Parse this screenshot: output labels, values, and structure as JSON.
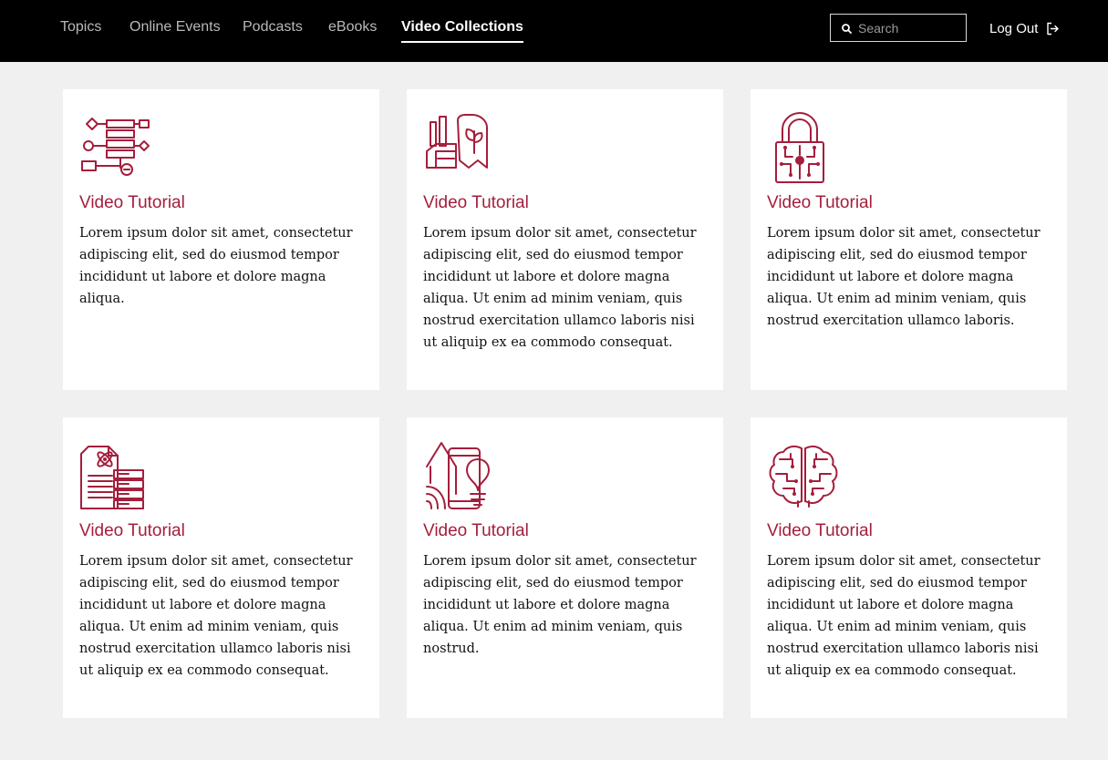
{
  "nav": {
    "items": [
      {
        "label": "Topics",
        "active": false
      },
      {
        "label": "Online Events",
        "active": false
      },
      {
        "label": "Podcasts",
        "active": false
      },
      {
        "label": "eBooks",
        "active": false
      },
      {
        "label": "Video Collections",
        "active": true
      }
    ],
    "search_placeholder": "Search",
    "logout_label": "Log Out"
  },
  "colors": {
    "accent": "#a51e3c",
    "header_bg": "#000000",
    "page_bg": "#f0f0f0"
  },
  "cards": [
    {
      "icon": "flowchart-icon",
      "title": "Video Tutorial",
      "text": "Lorem ipsum dolor sit amet, consectetur adipiscing elit, sed do eiusmod tempor incididunt ut labore et dolore magna aliqua."
    },
    {
      "icon": "eco-factory-icon",
      "title": "Video Tutorial",
      "text": "Lorem ipsum dolor sit amet, consectetur adipiscing elit, sed do eiusmod tempor incididunt ut labore et dolore magna aliqua. Ut enim ad minim veniam, quis nostrud exercitation ullamco laboris nisi ut aliquip ex ea commodo consequat."
    },
    {
      "icon": "circuit-lock-icon",
      "title": "Video Tutorial",
      "text": "Lorem ipsum dolor sit amet, consectetur adipiscing elit, sed do eiusmod tempor incididunt ut labore et dolore magna aliqua. Ut enim ad minim veniam, quis nostrud exercitation ullamco laboris."
    },
    {
      "icon": "science-server-icon",
      "title": "Video Tutorial",
      "text": "Lorem ipsum dolor sit amet, consectetur adipiscing elit, sed do eiusmod tempor incididunt ut labore et dolore magna aliqua. Ut enim ad minim veniam, quis nostrud exercitation ullamco laboris nisi ut aliquip ex ea commodo consequat."
    },
    {
      "icon": "smart-home-icon",
      "title": "Video Tutorial",
      "text": "Lorem ipsum dolor sit amet, consectetur adipiscing elit, sed do eiusmod tempor incididunt ut labore et dolore magna aliqua. Ut enim ad minim veniam, quis nostrud."
    },
    {
      "icon": "brain-icon",
      "title": "Video Tutorial",
      "text": "Lorem ipsum dolor sit amet, consectetur adipiscing elit, sed do eiusmod tempor incididunt ut labore et dolore magna aliqua. Ut enim ad minim veniam, quis nostrud exercitation ullamco laboris nisi ut aliquip ex ea commodo consequat."
    }
  ]
}
